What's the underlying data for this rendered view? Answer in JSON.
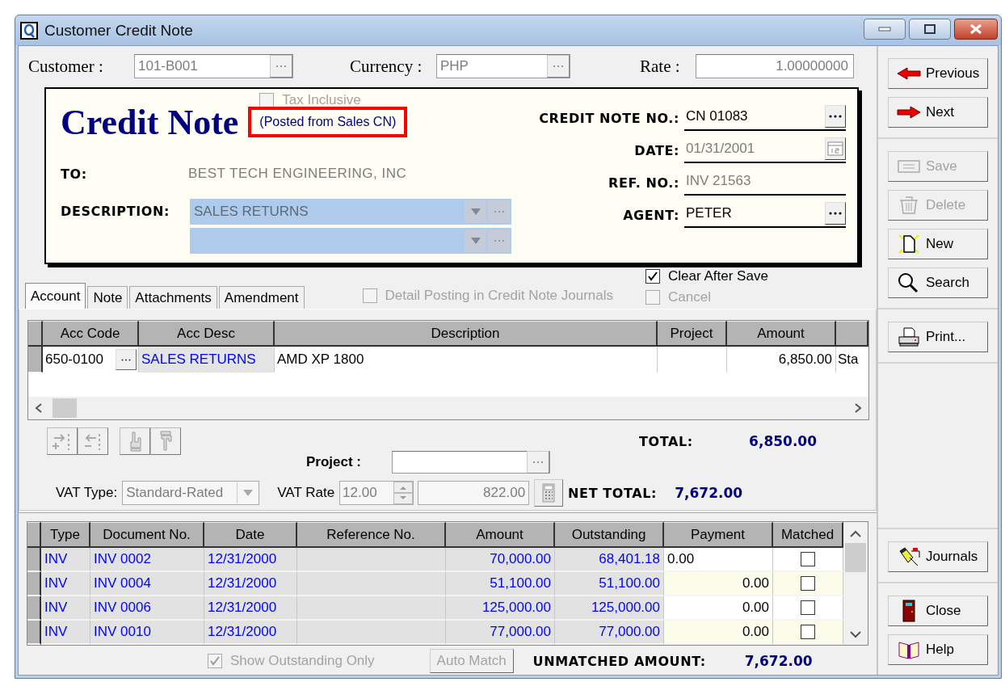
{
  "window": {
    "title": "Customer Credit Note"
  },
  "header": {
    "customer_label": "Customer :",
    "customer": "101-B001",
    "currency_label": "Currency :",
    "currency": "PHP",
    "rate_label": "Rate :",
    "rate": "1.00000000"
  },
  "card": {
    "title": "Credit Note",
    "posted_note": "(Posted from Sales CN)",
    "tax_inclusive": {
      "label": "Tax Inclusive",
      "checked": false,
      "disabled": true
    },
    "to_label": "TO:",
    "to": "BEST TECH ENGINEERING, INC",
    "description_label": "DESCRIPTION:",
    "description": "SALES RETURNS",
    "fields": [
      {
        "label": "CREDIT NOTE NO.:",
        "value": "CN 01083",
        "kind": "lookup",
        "disabled": false
      },
      {
        "label": "DATE:",
        "value": "01/31/2001",
        "kind": "date",
        "disabled": true
      },
      {
        "label": "REF. NO.:",
        "value": "INV 21563",
        "kind": "plain",
        "disabled": true
      },
      {
        "label": "AGENT:",
        "value": "PETER",
        "kind": "lookup",
        "disabled": false
      }
    ]
  },
  "tabs": [
    {
      "label": "Account",
      "selected": true
    },
    {
      "label": "Note",
      "selected": false
    },
    {
      "label": "Attachments",
      "selected": false
    },
    {
      "label": "Amendment",
      "selected": false
    }
  ],
  "detail_posting": {
    "label": "Detail Posting in Credit Note Journals",
    "checked": false,
    "disabled": true
  },
  "save_options": [
    {
      "label": "Clear After Save",
      "checked": true,
      "disabled": false
    },
    {
      "label": "Cancel",
      "checked": false,
      "disabled": true
    }
  ],
  "account_table": {
    "columns": [
      "Acc Code",
      "Acc Desc",
      "Description",
      "Project",
      "Amount"
    ],
    "rows": [
      {
        "acc_code": "650-0100",
        "acc_desc": "SALES RETURNS",
        "description": "AMD XP 1800",
        "amount": "6,850.00",
        "column_6": "Sta"
      }
    ]
  },
  "totals": {
    "total_label": "TOTAL:",
    "total": "6,850.00",
    "project_label": "Project :",
    "vat_type_label": "VAT Type:",
    "vat_type": "Standard-Rated",
    "vat_rate_label": "VAT Rate",
    "vat_rate": "12.00",
    "vat_amount": "822.00",
    "net_total_label": "NET TOTAL:",
    "net_total": "7,672.00"
  },
  "invoice_table": {
    "columns": [
      "Type",
      "Document No.",
      "Date",
      "Reference No.",
      "Amount",
      "Outstanding",
      "Payment",
      "Matched"
    ],
    "rows": [
      {
        "type": "INV",
        "document_no": "INV 0002",
        "date": "12/31/2000",
        "amount": "70,000.00",
        "outstanding": "68,401.18",
        "payment": "0.00",
        "editing": true,
        "matched": false
      },
      {
        "type": "INV",
        "document_no": "INV 0004",
        "date": "12/31/2000",
        "amount": "51,100.00",
        "outstanding": "51,100.00",
        "payment": "0.00",
        "editing": false,
        "matched": false
      },
      {
        "type": "INV",
        "document_no": "INV 0006",
        "date": "12/31/2000",
        "amount": "125,000.00",
        "outstanding": "125,000.00",
        "payment": "0.00",
        "editing": false,
        "matched": false
      },
      {
        "type": "INV",
        "document_no": "INV 0010",
        "date": "12/31/2000",
        "amount": "77,000.00",
        "outstanding": "77,000.00",
        "payment": "0.00",
        "editing": false,
        "matched": false
      }
    ]
  },
  "footer": {
    "show_outstanding": {
      "label": "Show Outstanding Only",
      "checked": true,
      "disabled": true
    },
    "auto_match": {
      "label": "Auto Match",
      "disabled": true
    },
    "unmatched_label": "UNMATCHED AMOUNT:",
    "unmatched": "7,672.00"
  },
  "side_groups": [
    {
      "buttons": [
        {
          "label": "Previous",
          "kind": "previous",
          "disabled": false
        },
        {
          "label": "Next",
          "kind": "next",
          "disabled": false
        }
      ]
    },
    {
      "buttons": [
        {
          "label": "Save",
          "kind": "save",
          "disabled": true
        },
        {
          "label": "Delete",
          "kind": "delete",
          "disabled": true
        },
        {
          "label": "New",
          "kind": "new",
          "disabled": false
        },
        {
          "label": "Search",
          "kind": "search",
          "disabled": false
        }
      ]
    },
    {
      "buttons": [
        {
          "label": "Print...",
          "kind": "print",
          "disabled": false
        }
      ]
    },
    {
      "buttons": [
        {
          "label": "Journals",
          "kind": "journals",
          "disabled": false
        }
      ]
    },
    {
      "buttons": [
        {
          "label": "Close",
          "kind": "close",
          "disabled": false
        },
        {
          "label": "Help",
          "kind": "help",
          "disabled": false
        }
      ]
    }
  ]
}
